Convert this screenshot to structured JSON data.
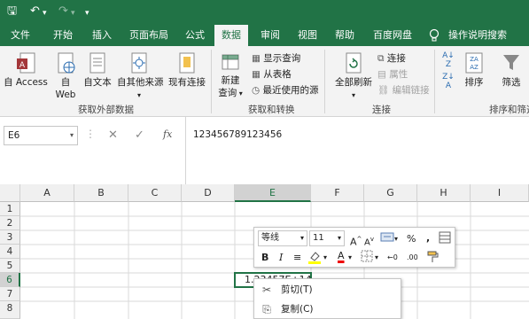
{
  "qat": {
    "save": "🖫",
    "undo": "↶",
    "redo": "↷",
    "more": "▾",
    "undo_menu": "▾",
    "redo_menu": "▾"
  },
  "tabs": [
    {
      "label": "文件"
    },
    {
      "label": "开始"
    },
    {
      "label": "插入"
    },
    {
      "label": "页面布局"
    },
    {
      "label": "公式"
    },
    {
      "label": "数据",
      "active": true
    },
    {
      "label": "审阅"
    },
    {
      "label": "视图"
    },
    {
      "label": "帮助"
    },
    {
      "label": "百度网盘"
    },
    {
      "label": "操作说明搜索"
    }
  ],
  "ribbon": {
    "access": "自 Access",
    "web1": "自",
    "web2": "Web",
    "text": "自文本",
    "other": "自其他来源",
    "existing": "现有连接",
    "group_external": "获取外部数据",
    "newquery1": "新建",
    "newquery2": "查询",
    "show_query": "显示查询",
    "from_table": "从表格",
    "recent": "最近使用的源",
    "group_transform": "获取和转换",
    "refresh_all": "全部刷新",
    "connections": "连接",
    "properties": "属性",
    "edit_links": "编辑链接",
    "group_connections": "连接",
    "sort": "排序",
    "filter": "筛选",
    "group_sort": "排序和筛选"
  },
  "formula_bar": {
    "namebox": "E6",
    "cancel": "✕",
    "enter": "✓",
    "fx": "fx",
    "content": "123456789123456"
  },
  "grid": {
    "columns": [
      "A",
      "B",
      "C",
      "D",
      "E",
      "F",
      "G",
      "H",
      "I"
    ],
    "rows": [
      "1",
      "2",
      "3",
      "4",
      "5",
      "6",
      "7",
      "8"
    ],
    "cell_e6": "1.23457E+14"
  },
  "mini_toolbar": {
    "font": "等线",
    "size": "11",
    "grow": "A",
    "shrink": "A",
    "percent": "%",
    "comma": ",",
    "bold": "B",
    "italic": "I",
    "align": "≡",
    "fontcolor": "A",
    "inc": "←0",
    "dec": ".00"
  },
  "context_menu": [
    {
      "label": "剪切(T)",
      "icon": "✂"
    },
    {
      "label": "复制(C)",
      "icon": "⎘"
    }
  ],
  "colors": {
    "brand": "#217346",
    "select": "#217346"
  }
}
